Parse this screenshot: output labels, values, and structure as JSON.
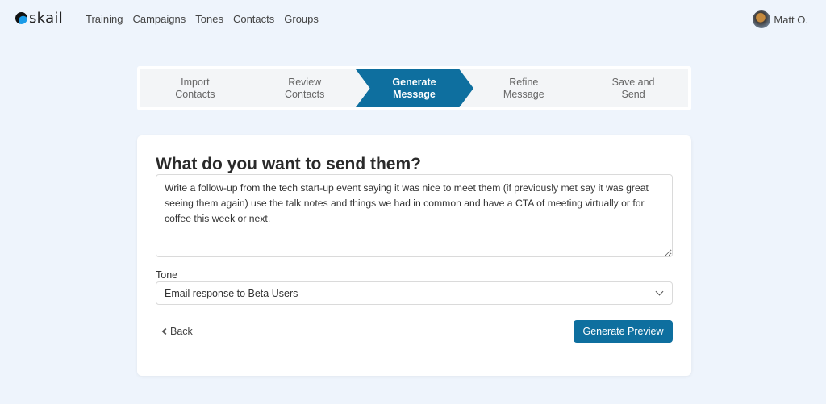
{
  "brand": {
    "name": "skail",
    "accent": "#0e6f9f"
  },
  "nav": {
    "items": [
      {
        "label": "Training"
      },
      {
        "label": "Campaigns"
      },
      {
        "label": "Tones"
      },
      {
        "label": "Contacts"
      },
      {
        "label": "Groups"
      }
    ]
  },
  "user": {
    "name": "Matt O."
  },
  "stepper": {
    "steps": [
      {
        "line1": "Import",
        "line2": "Contacts"
      },
      {
        "line1": "Review",
        "line2": "Contacts"
      },
      {
        "line1": "Generate",
        "line2": "Message"
      },
      {
        "line1": "Refine",
        "line2": "Message"
      },
      {
        "line1": "Save and",
        "line2": "Send"
      }
    ],
    "active_index": 2
  },
  "form": {
    "title": "What do you want to send them?",
    "message": "Write a follow-up from the tech start-up event saying it was nice to meet them (if previously met say it was great seeing them again) use the talk notes and things we had in common and have a CTA of meeting virtually or for coffee this week or next.",
    "tone_label": "Tone",
    "tone_value": "Email response to Beta Users",
    "back_label": "Back",
    "submit_label": "Generate Preview"
  }
}
